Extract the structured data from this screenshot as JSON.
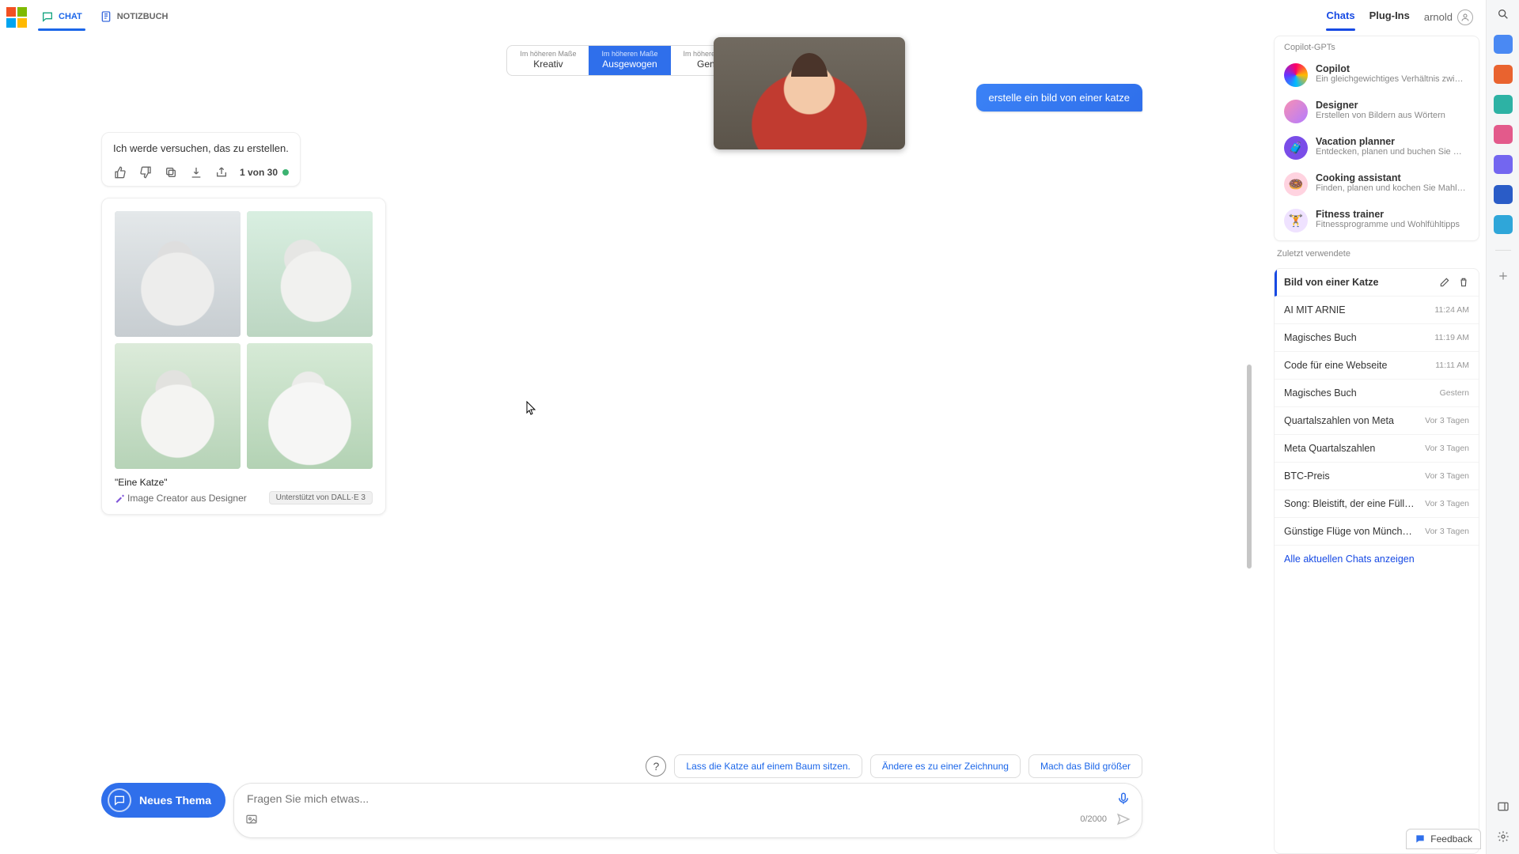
{
  "top": {
    "chat_tab": "CHAT",
    "notebook_tab": "NOTIZBUCH",
    "right_chats": "Chats",
    "right_plugins": "Plug-Ins",
    "username": "arnold"
  },
  "style": {
    "prefix": "Im höheren Maße",
    "creative": "Kreativ",
    "balanced": "Ausgewogen",
    "precise": "Genau"
  },
  "chat": {
    "user_prompt": "erstelle ein bild von einer katze",
    "ai_reply": "Ich werde versuchen, das zu erstellen.",
    "counter": "1 von 30",
    "caption": "\"Eine Katze\"",
    "source": "Image Creator aus Designer",
    "powered": "Unterstützt von DALL·E 3"
  },
  "suggestions": {
    "s1": "Lass die Katze auf einem Baum sitzen.",
    "s2": "Ändere es zu einer Zeichnung",
    "s3": "Mach das Bild größer"
  },
  "composer": {
    "new_topic": "Neues Thema",
    "placeholder": "Fragen Sie mich etwas...",
    "count": "0/2000"
  },
  "gpts": {
    "section_title": "Copilot-GPTs",
    "items": [
      {
        "name": "Copilot",
        "desc": "Ein gleichgewichtiges Verhältnis zwischen KI u"
      },
      {
        "name": "Designer",
        "desc": "Erstellen von Bildern aus Wörtern"
      },
      {
        "name": "Vacation planner",
        "desc": "Entdecken, planen und buchen Sie Reisen"
      },
      {
        "name": "Cooking assistant",
        "desc": "Finden, planen und kochen Sie Mahlzeiten"
      },
      {
        "name": "Fitness trainer",
        "desc": "Fitnessprogramme und Wohlfühltipps"
      }
    ]
  },
  "recents": {
    "title": "Zuletzt verwendete",
    "items": [
      {
        "title": "Bild von einer Katze",
        "time": ""
      },
      {
        "title": "AI MIT ARNIE",
        "time": "11:24 AM"
      },
      {
        "title": "Magisches Buch",
        "time": "11:19 AM"
      },
      {
        "title": "Code für eine Webseite",
        "time": "11:11 AM"
      },
      {
        "title": "Magisches Buch",
        "time": "Gestern"
      },
      {
        "title": "Quartalszahlen von Meta",
        "time": "Vor 3 Tagen"
      },
      {
        "title": "Meta Quartalszahlen",
        "time": "Vor 3 Tagen"
      },
      {
        "title": "BTC-Preis",
        "time": "Vor 3 Tagen"
      },
      {
        "title": "Song: Bleistift, der eine Füllfeder sein m",
        "time": "Vor 3 Tagen"
      },
      {
        "title": "Günstige Flüge von München nach Fra",
        "time": "Vor 3 Tagen"
      }
    ],
    "show_all": "Alle aktuellen Chats anzeigen"
  },
  "feedback_label": "Feedback"
}
